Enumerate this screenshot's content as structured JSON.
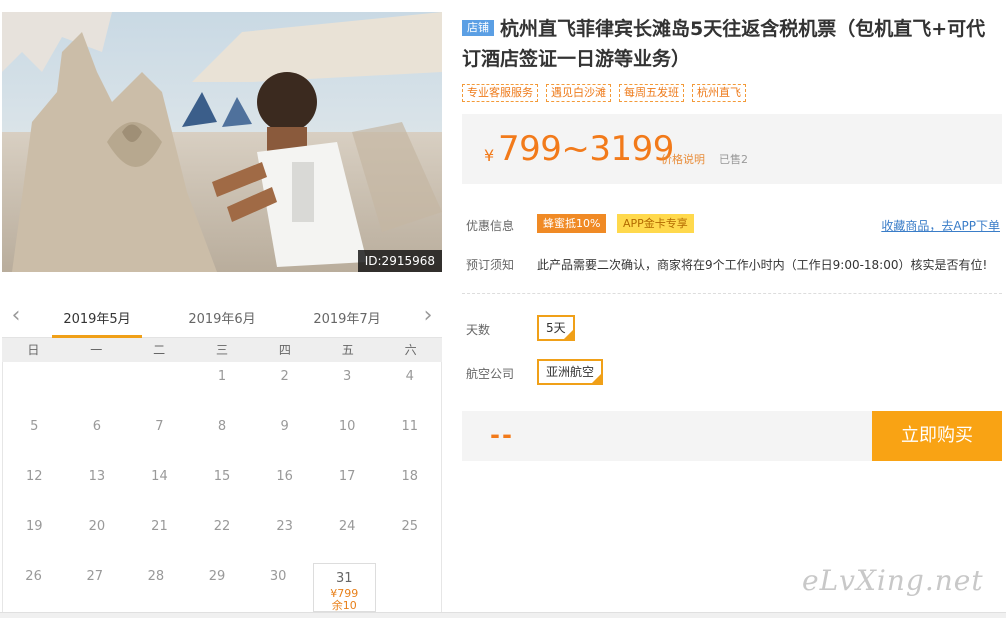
{
  "hero": {
    "image_id": "ID:2915968"
  },
  "calendar": {
    "months": [
      "2019年5月",
      "2019年6月",
      "2019年7月"
    ],
    "active_month": 0,
    "weekdays": [
      "日",
      "一",
      "二",
      "三",
      "四",
      "五",
      "六"
    ],
    "weeks": [
      [
        "",
        "",
        "",
        "1",
        "2",
        "3",
        "4"
      ],
      [
        "5",
        "6",
        "7",
        "8",
        "9",
        "10",
        "11"
      ],
      [
        "12",
        "13",
        "14",
        "15",
        "16",
        "17",
        "18"
      ],
      [
        "19",
        "20",
        "21",
        "22",
        "23",
        "24",
        "25"
      ],
      [
        "26",
        "27",
        "28",
        "29",
        "30",
        "31",
        ""
      ]
    ],
    "available": {
      "day": "31",
      "price": "¥799",
      "stock": "余10"
    }
  },
  "product": {
    "shop_badge": "店铺",
    "title": "杭州直飞菲律宾长滩岛5天往返含税机票（包机直飞+可代订酒店签证一日游等业务）",
    "tags": [
      "专业客服服务",
      "遇见白沙滩",
      "每周五发班",
      "杭州直飞"
    ],
    "price": {
      "currency": "¥",
      "value": "799~3199",
      "note": "价格说明",
      "sold": "已售2"
    },
    "promo": {
      "label": "优惠信息",
      "badge1": "蜂蜜抵10%",
      "badge2": "APP金卡专享",
      "link": "收藏商品，去APP下单"
    },
    "booking": {
      "label": "预订须知",
      "text": "此产品需要二次确认，商家将在9个工作小时内（工作日9:00-18:00）核实是否有位!"
    },
    "options": {
      "days_label": "天数",
      "days_value": "5天",
      "airline_label": "航空公司",
      "airline_value": "亚洲航空"
    },
    "buy": {
      "placeholder": "--",
      "button": "立即购买"
    }
  },
  "watermark": "eLvXing.net"
}
